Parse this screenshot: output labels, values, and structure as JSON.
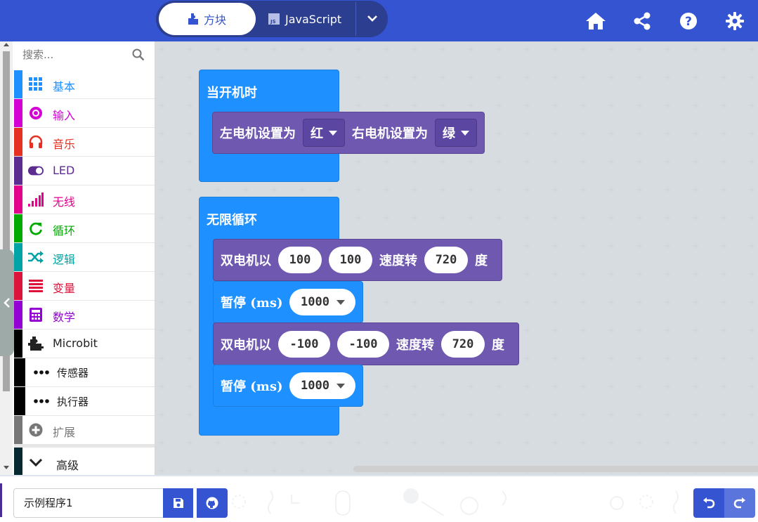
{
  "colors": {
    "header": "#3454d1",
    "hat_block": "#1e90ff",
    "motor_block": "#6f58b0"
  },
  "header": {
    "tabs": [
      {
        "label": "方块",
        "icon": "puzzle-icon",
        "selected": true
      },
      {
        "label": "JavaScript",
        "icon": "js-icon",
        "selected": false
      }
    ],
    "icons": [
      "home-icon",
      "share-icon",
      "help-icon",
      "settings-icon"
    ]
  },
  "sidebar": {
    "search_placeholder": "搜索...",
    "categories": [
      {
        "label": "基本",
        "color": "#1e90ff",
        "icon": "grid-icon"
      },
      {
        "label": "输入",
        "color": "#d400d4",
        "icon": "target-icon"
      },
      {
        "label": "音乐",
        "color": "#e63022",
        "icon": "headphones-icon"
      },
      {
        "label": "LED",
        "color": "#5c2d91",
        "icon": "toggle-icon"
      },
      {
        "label": "无线",
        "color": "#e3008c",
        "icon": "signal-icon"
      },
      {
        "label": "循环",
        "color": "#00aa00",
        "icon": "refresh-icon"
      },
      {
        "label": "逻辑",
        "color": "#00a4a6",
        "icon": "shuffle-icon"
      },
      {
        "label": "变量",
        "color": "#dc143c",
        "icon": "list-icon"
      },
      {
        "label": "数学",
        "color": "#9400d3",
        "icon": "calculator-icon"
      },
      {
        "label": "Microbit",
        "color": "#000000",
        "icon": "puzzle-icon"
      }
    ],
    "subcategories": [
      {
        "label": "传感器",
        "icon": "more-icon"
      },
      {
        "label": "执行器",
        "icon": "more-icon"
      }
    ],
    "extensions": {
      "label": "扩展",
      "color": "#777777",
      "icon": "plus-circle-icon"
    },
    "advanced": {
      "label": "高级",
      "icon": "chevron-down-icon"
    }
  },
  "workspace": {
    "start_block": {
      "title": "当开机时",
      "motor_set": {
        "left_label": "左电机设置为",
        "left_value": "红",
        "right_label": "右电机设置为",
        "right_value": "绿"
      }
    },
    "forever_block": {
      "title": "无限循环",
      "steps": [
        {
          "type": "motors",
          "label": "双电机以",
          "a": "100",
          "b": "100",
          "speed_label": "速度转",
          "deg": "720",
          "unit": "度"
        },
        {
          "type": "pause",
          "label": "暂停 (ms)",
          "value": "1000"
        },
        {
          "type": "motors",
          "label": "双电机以",
          "a": "-100",
          "b": "-100",
          "speed_label": "速度转",
          "deg": "720",
          "unit": "度"
        },
        {
          "type": "pause",
          "label": "暂停 (ms)",
          "value": "1000"
        }
      ]
    }
  },
  "footer": {
    "project_name": "示例程序1",
    "buttons": [
      "save-icon",
      "github-icon",
      "undo-icon",
      "redo-icon"
    ]
  }
}
